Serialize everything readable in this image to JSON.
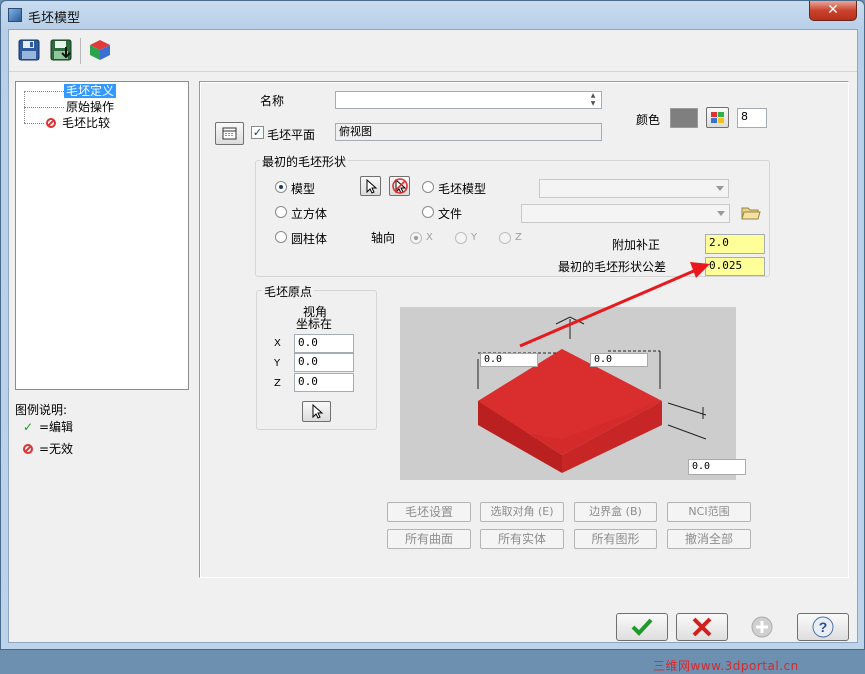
{
  "window": {
    "title": "毛坯模型",
    "close_symbol": "✕"
  },
  "toolbar": {
    "icons": [
      "save-icon",
      "save-as-icon",
      "solid-block-icon"
    ]
  },
  "tree": {
    "items": [
      {
        "label": "毛坯定义",
        "selected": true
      },
      {
        "label": "原始操作"
      },
      {
        "label": "毛坯比较",
        "icon": "invalid-icon"
      }
    ]
  },
  "legend": {
    "title": "图例说明:",
    "items": [
      {
        "icon": "check-icon",
        "symbol": "✓",
        "label": "=编辑"
      },
      {
        "icon": "invalid-icon",
        "label": "=无效"
      }
    ]
  },
  "form": {
    "name_label": "名称",
    "name_value": "",
    "plane_checkbox_label": "毛坯平面",
    "plane_checked": true,
    "plane_value": "俯视图",
    "color_label": "颜色",
    "color_hex": "#7f7f7f",
    "color_number": "8"
  },
  "shape_group": {
    "title": "最初的毛坯形状",
    "options": {
      "model": "模型",
      "stock_model": "毛坯模型",
      "cube": "立方体",
      "file": "文件",
      "cylinder": "圆柱体"
    },
    "selected": "模型",
    "axis_label": "轴向",
    "axes": [
      "X",
      "Y",
      "Z"
    ],
    "axis_selected": "X",
    "extra_offset_label": "附加补正",
    "extra_offset_value": "2.0",
    "tolerance_label": "最初的毛坯形状公差",
    "tolerance_value": "0.025"
  },
  "origin_group": {
    "title": "毛坯原点",
    "view_label": "视角",
    "coord_label": "坐标在",
    "x_label": "X",
    "x_value": "0.0",
    "y_label": "Y",
    "y_value": "0.0",
    "z_label": "Z",
    "z_value": "0.0"
  },
  "preview": {
    "block_color": "#d42a2a",
    "dim_a": "0.0",
    "dim_b": "0.0",
    "dim_c": "0.0"
  },
  "buttons": {
    "stock_setup": "毛坯设置",
    "select_corners": "选取对角 (E)",
    "bounding_box": "边界盒 (B)",
    "nci_range": "NCI范围",
    "all_surfaces": "所有曲面",
    "all_solids": "所有实体",
    "all_geometry": "所有图形",
    "deselect_all": "撤消全部"
  },
  "dialog_buttons": {
    "ok_icon": "checkmark-icon",
    "cancel_icon": "x-icon",
    "apply_icon": "plus-icon",
    "help_icon": "help-icon"
  },
  "watermark": "三维网www.3dportal.cn"
}
